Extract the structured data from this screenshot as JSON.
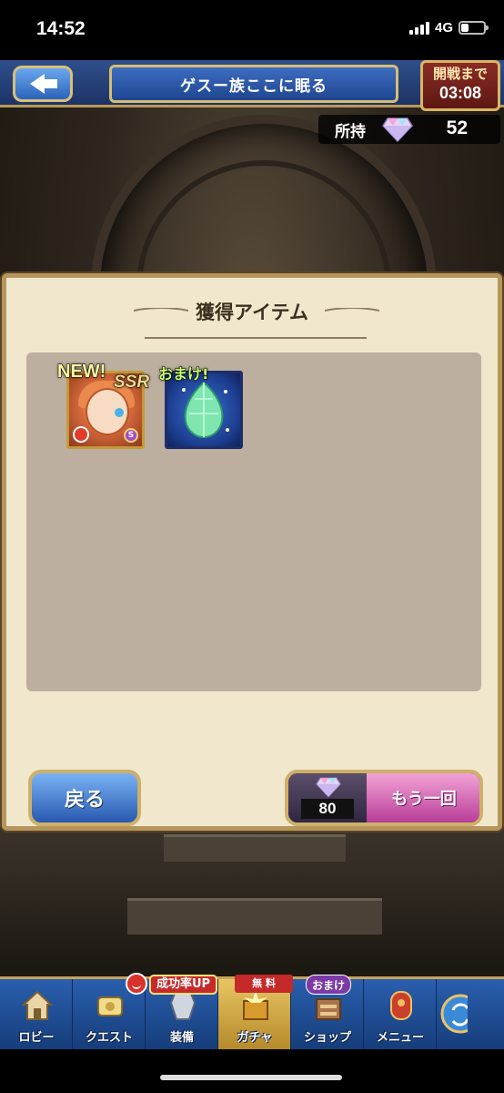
{
  "status_bar": {
    "time": "14:52",
    "network": "4G"
  },
  "header": {
    "title": "ゲスー族ここに眠る",
    "event_timer": {
      "label": "開戦まで",
      "time": "03:08"
    }
  },
  "currency": {
    "label": "所持",
    "value": "52",
    "icon": "gem-icon"
  },
  "panel": {
    "title": "獲得アイテム",
    "items": [
      {
        "tag": "NEW!",
        "rarity": "SSR",
        "icon": "character-portrait"
      },
      {
        "tag": "おまけ!",
        "icon": "green-gem-icon"
      }
    ],
    "back_label": "戻る",
    "again_label": "もう一回",
    "again_cost": "80"
  },
  "nav": {
    "badges": {
      "success_up": "成功率UP",
      "free": "無 料",
      "bonus": "おまけ"
    },
    "items": [
      {
        "label": "ロビー",
        "icon": "lobby-icon"
      },
      {
        "label": "クエスト",
        "icon": "quest-icon"
      },
      {
        "label": "装備",
        "icon": "equipment-icon"
      },
      {
        "label": "ガチャ",
        "icon": "gacha-icon"
      },
      {
        "label": "ショップ",
        "icon": "shop-icon"
      },
      {
        "label": "メニュー",
        "icon": "menu-icon"
      }
    ]
  },
  "colors": {
    "accent_gold": "#cdb06a",
    "nav_blue": "#2a5fae",
    "panel_bg": "#f1e7cc"
  }
}
